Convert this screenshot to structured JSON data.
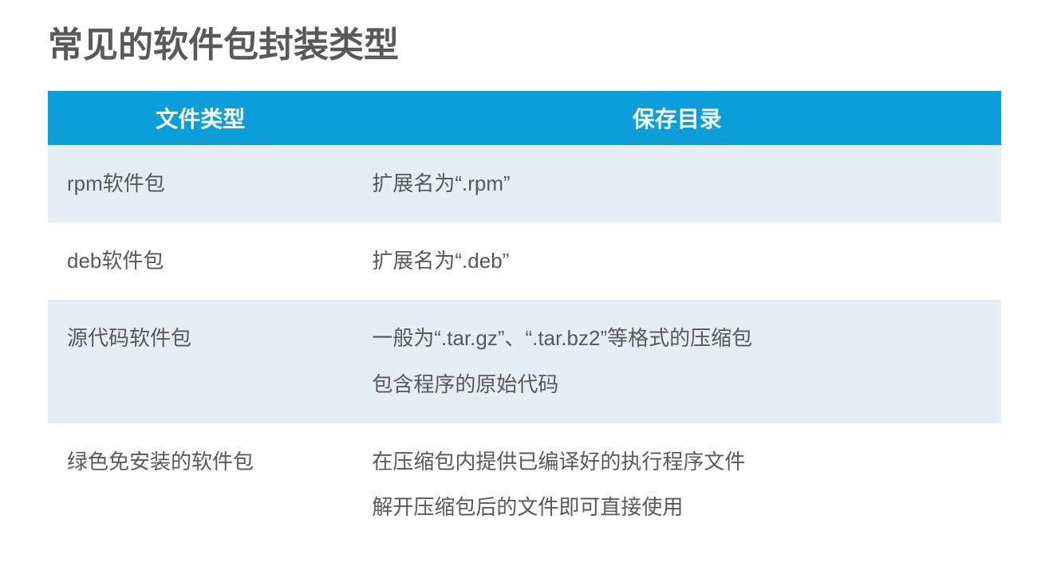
{
  "title": "常见的软件包封装类型",
  "table": {
    "headers": [
      "文件类型",
      "保存目录"
    ],
    "rows": [
      {
        "col1": "rpm软件包",
        "col2_lines": [
          "扩展名为“.rpm”"
        ]
      },
      {
        "col1": "deb软件包",
        "col2_lines": [
          "扩展名为“.deb”"
        ]
      },
      {
        "col1": "源代码软件包",
        "col2_lines": [
          "一般为“.tar.gz”、“.tar.bz2”等格式的压缩包",
          "包含程序的原始代码"
        ]
      },
      {
        "col1": "绿色免安装的软件包",
        "col2_lines": [
          "在压缩包内提供已编译好的执行程序文件",
          "解开压缩包后的文件即可直接使用"
        ]
      }
    ]
  }
}
